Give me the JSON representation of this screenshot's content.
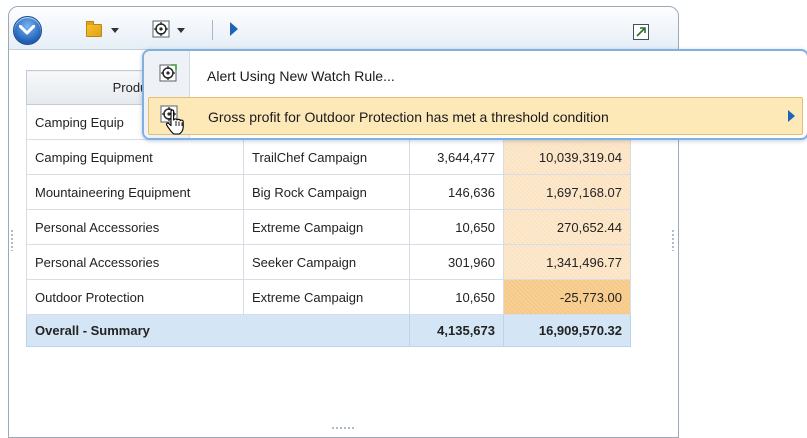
{
  "toolbar": {
    "main_menu_icon": "chevron-down-icon",
    "folder_icon": "folder-icon",
    "watch_icon": "watch-rule-icon",
    "run_icon": "play-icon",
    "restore_icon": "restore-window-icon"
  },
  "table": {
    "columns": [
      "Product",
      "",
      "",
      ""
    ],
    "rows": [
      {
        "product": "Camping Equip",
        "campaign": "",
        "quantity": "",
        "gross_profit": ""
      },
      {
        "product": "Camping Equipment",
        "campaign": "TrailChef Campaign",
        "quantity": "3,644,477",
        "gross_profit": "10,039,319.04"
      },
      {
        "product": "Mountaineering Equipment",
        "campaign": "Big Rock Campaign",
        "quantity": "146,636",
        "gross_profit": "1,697,168.07"
      },
      {
        "product": "Personal Accessories",
        "campaign": "Extreme Campaign",
        "quantity": "10,650",
        "gross_profit": "270,652.44"
      },
      {
        "product": "Personal Accessories",
        "campaign": "Seeker Campaign",
        "quantity": "301,960",
        "gross_profit": "1,341,496.77"
      },
      {
        "product": "Outdoor Protection",
        "campaign": "Extreme Campaign",
        "quantity": "10,650",
        "gross_profit": "-25,773.00"
      }
    ],
    "summary": {
      "label": "Overall - Summary",
      "quantity": "4,135,673",
      "gross_profit": "16,909,570.32"
    }
  },
  "context_menu": {
    "items": [
      {
        "label": "Alert Using New Watch Rule...",
        "icon": "watch-rule-icon",
        "submenu": false
      },
      {
        "label": "Gross profit for Outdoor Protection has met a threshold condition",
        "icon": "watch-rule-icon",
        "submenu": true
      }
    ]
  },
  "colors": {
    "accent": "#1d64b8",
    "menu_highlight": "#fde8b8",
    "summary_row": "#d4e6f6",
    "threshold_cell": "#f6c987"
  }
}
